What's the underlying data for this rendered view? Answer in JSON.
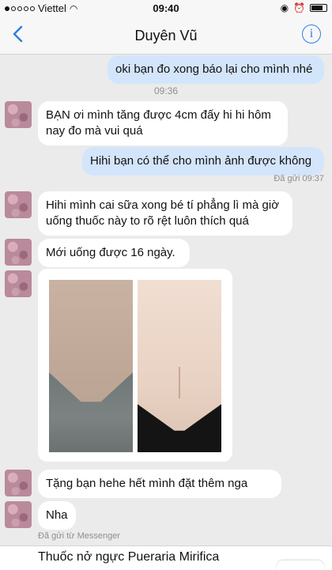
{
  "status_bar": {
    "carrier": "Viettel",
    "time": "09:40"
  },
  "nav": {
    "title": "Duyên Vũ",
    "info_symbol": "i"
  },
  "messages": [
    {
      "direction": "out",
      "text": "oki bạn đo xong báo lại cho mình nhé"
    },
    {
      "direction": "in",
      "text": "BẠN ơi mình tăng được 4cm đấy hi hi hôm nay đo mà vui quá"
    },
    {
      "direction": "out",
      "text": "Hihi bạn có thể cho mình ảnh được không"
    },
    {
      "direction": "in",
      "text": "Hihi mình cai sữa xong bé tí phẳng lì mà giờ uống thuốc này to rõ rệt luôn thích quá"
    },
    {
      "direction": "in",
      "text": "Mới uống được 16 ngày."
    },
    {
      "direction": "in",
      "type": "photo"
    },
    {
      "direction": "in",
      "text": "Tặng bạn hehe hết mình đặt thêm nga"
    },
    {
      "direction": "in",
      "text": "Nha"
    }
  ],
  "timestamp_separator": "09:36",
  "delivered_1": "Đã gửi 09:37",
  "delivered_2": "Đã gửi từ Messenger",
  "footer_text": "Thuốc nở ngực Pueraria Mirifica",
  "colors": {
    "accent": "#2f7fe0",
    "outgoing_bubble": "#d3e5fb",
    "incoming_bubble": "#ffffff",
    "background": "#ebebeb"
  }
}
